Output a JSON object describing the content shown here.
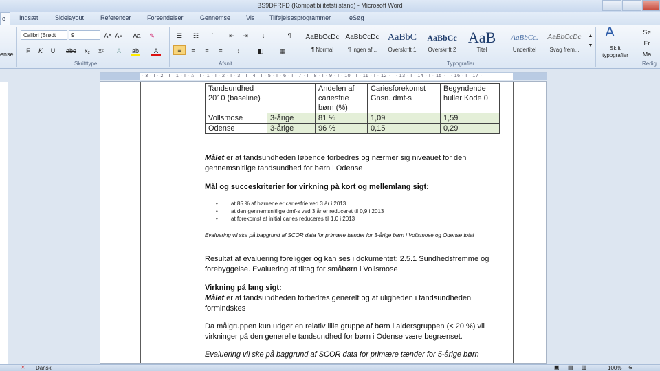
{
  "window": {
    "title": "BS9DFRFD (Kompatibilitetstilstand) - Microsoft Word"
  },
  "tabs": [
    "e",
    "Indsæt",
    "Sidelayout",
    "Referencer",
    "Forsendelser",
    "Gennemse",
    "Vis",
    "Tilføjelsesprogrammer",
    "eSøg"
  ],
  "ribbon": {
    "clipboard_partial": "ensel",
    "font_name": "Calibri (Brødt",
    "font_size": "9",
    "grow_font": "A˄",
    "shrink_font": "A˅",
    "change_case": "Aa",
    "bold": "F",
    "italic": "K",
    "underline": "U",
    "strike": "abe",
    "subscript": "x₂",
    "superscript": "x²",
    "font_color": "A",
    "highlight": "ab",
    "groups": {
      "font": "Skrifttype",
      "paragraph": "Afsnit",
      "styles": "Typografier",
      "editing_partial": "Redig"
    },
    "styles": [
      {
        "preview": "AaBbCcDc",
        "name": "¶ Normal"
      },
      {
        "preview": "AaBbCcDc",
        "name": "¶ Ingen af..."
      },
      {
        "preview": "AaBbC",
        "name": "Overskrift 1"
      },
      {
        "preview": "AaBbCc",
        "name": "Overskrift 2"
      },
      {
        "preview": "AaB",
        "name": "Titel"
      },
      {
        "preview": "AaBbCc.",
        "name": "Undertitel"
      },
      {
        "preview": "AaBbCcDc",
        "name": "Svag frem..."
      }
    ],
    "change_styles": "Skift typografier",
    "find_partial": "Sø",
    "replace_partial": "Er",
    "select_partial": "Ma"
  },
  "ruler": {
    "ticks": "· 3 · ı · 2 · ı · 1 · ı · ⌂ · ı · 1 · ı · 2 · ı · 3 · ı · 4 · ı · 5 · ı · 6 · ı · 7 · ı · 8 · ı · 9 · ı · 10 · ı · 11 · ı · 12 · ı · 13 · ı · 14 · ı · 15 · ı · 16 · ı · 17 ·"
  },
  "document": {
    "table": {
      "header": [
        "Tandsundhed 2010 (baseline)",
        "",
        "Andelen af cariesfrie børn (%)",
        "Cariesforekomst Gnsn. dmf-s",
        "Begyndende huller Kode 0"
      ],
      "rows": [
        [
          "Vollsmose",
          "3-årige",
          "81 %",
          "1,09",
          "1,59"
        ],
        [
          "Odense",
          "3-årige",
          "96 %",
          "0,15",
          "0,29"
        ]
      ]
    },
    "goal_label": "Målet",
    "goal_text": " er at tandsundheden løbende forbedres og nærmer sig niveauet for den gennemsnitlige tandsundhed for børn i Odense",
    "short_term_heading": "Mål og succeskriterier for virkning på kort og mellemlang sigt:",
    "bullets": [
      "at 85 % af børnene er cariesfrie ved 3 år i 2013",
      "at den gennemsnitlige dmf-s ved 3 år er reduceret til 0,9 i 2013",
      "at forekomst af initial caries reduceres til 1,0 i 2013"
    ],
    "evaluation_note": "Evaluering vil ske på baggrund af SCOR data for primære tænder for 3-årige børn i Vollsmose og Odense total",
    "result_text": "Resultat af evaluering foreligger og kan ses i dokumentet: 2.5.1 Sundhedsfremme og forebyggelse. Evaluering af tiltag for småbørn i Vollsmose",
    "long_term_heading": "Virkning på lang sigt:",
    "long_goal_text": " er at tandsundheden forbedres generelt og at uligheden i tandsundheden formindskes",
    "target_group_text": "Da målgruppen kun udgør en relativ lille gruppe af børn i aldersgruppen (< 20 %) vil virkninger på den generelle tandsundhed for børn i Odense være begrænset.",
    "evaluation_note_2": "Evaluering vil ske på baggrund af SCOR data for primære tænder for 5-årige børn"
  },
  "status": {
    "language": "Dansk",
    "zoom": "100%"
  }
}
